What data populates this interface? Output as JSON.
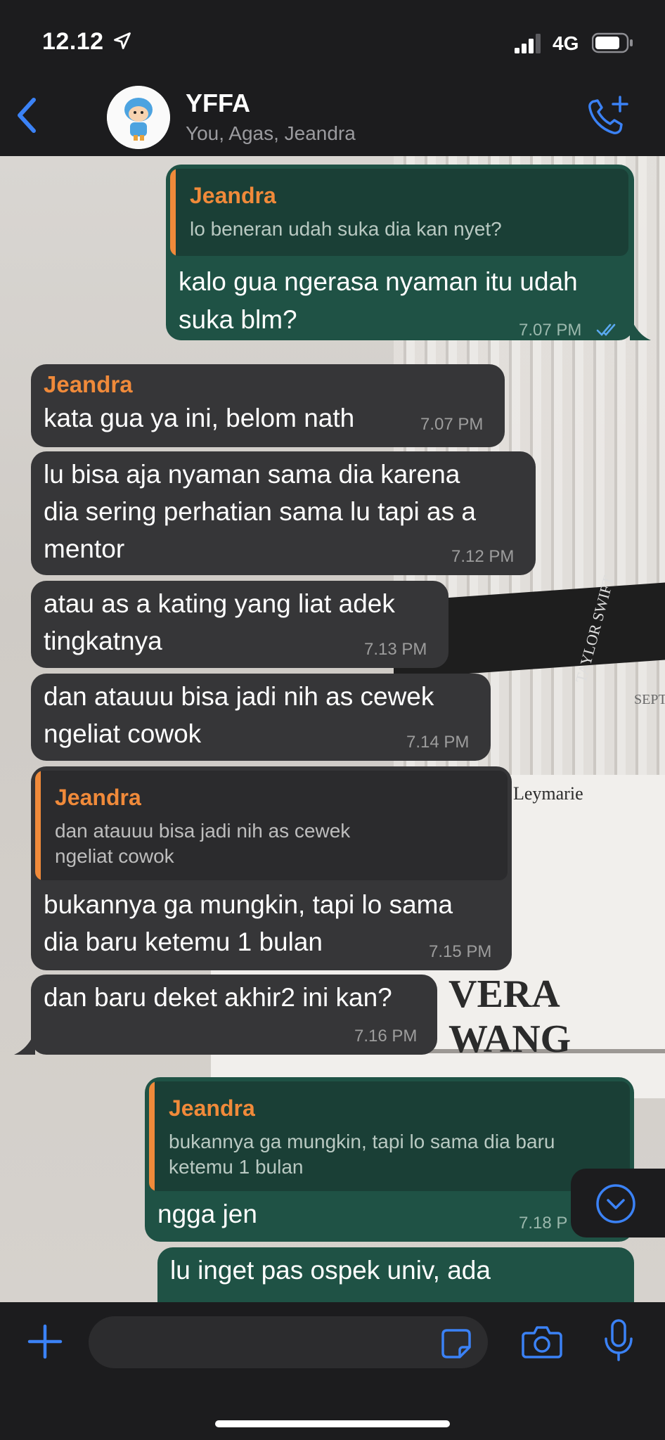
{
  "status_bar": {
    "time": "12.12",
    "network": "4G"
  },
  "header": {
    "title": "YFFA",
    "subtitle": "You, Agas, Jeandra",
    "back_icon": "chevron-left-icon",
    "call_icon": "phone-add-icon"
  },
  "background_text": {
    "book1": "Leymarie",
    "book2": "VERA WANG",
    "book3": "SEPT",
    "book4": "TAYLOR SWIFT"
  },
  "colors": {
    "incoming": "#363638",
    "outgoing": "#1f5245",
    "sender": "#f08a3a",
    "accent": "#3b82f6"
  },
  "messages": [
    {
      "dir": "out",
      "quote": {
        "sender": "Jeandra",
        "text": "lo beneran udah suka dia kan nyet?"
      },
      "lines": [
        "kalo gua ngerasa nyaman itu udah",
        "suka blm?"
      ],
      "time": "7.07 PM",
      "read": true
    },
    {
      "dir": "in",
      "sender": "Jeandra",
      "lines": [
        "kata gua ya ini, belom nath"
      ],
      "time": "7.07 PM"
    },
    {
      "dir": "in",
      "lines": [
        "lu bisa aja nyaman sama dia karena",
        "dia sering perhatian sama lu tapi as a",
        "mentor"
      ],
      "time": "7.12 PM"
    },
    {
      "dir": "in",
      "lines": [
        "atau as a kating yang liat adek",
        "tingkatnya"
      ],
      "time": "7.13 PM"
    },
    {
      "dir": "in",
      "lines": [
        "dan atauuu bisa jadi nih as cewek",
        "ngeliat cowok"
      ],
      "time": "7.14 PM"
    },
    {
      "dir": "in",
      "quote": {
        "sender": "Jeandra",
        "lines": [
          "dan atauuu bisa jadi nih as cewek",
          "ngeliat cowok"
        ]
      },
      "lines": [
        "bukannya ga mungkin, tapi lo sama",
        "dia baru ketemu 1 bulan"
      ],
      "time": "7.15 PM"
    },
    {
      "dir": "in",
      "lines": [
        "dan baru deket akhir2 ini kan?"
      ],
      "time": "7.16 PM"
    },
    {
      "dir": "out",
      "quote": {
        "sender": "Jeandra",
        "lines": [
          "bukannya ga mungkin, tapi lo sama dia baru",
          "ketemu 1 bulan"
        ]
      },
      "lines": [
        "ngga jen"
      ],
      "time": "7.18 P"
    },
    {
      "dir": "out",
      "lines": [
        "lu inget pas ospek univ, ada"
      ]
    }
  ],
  "input": {
    "placeholder": ""
  }
}
